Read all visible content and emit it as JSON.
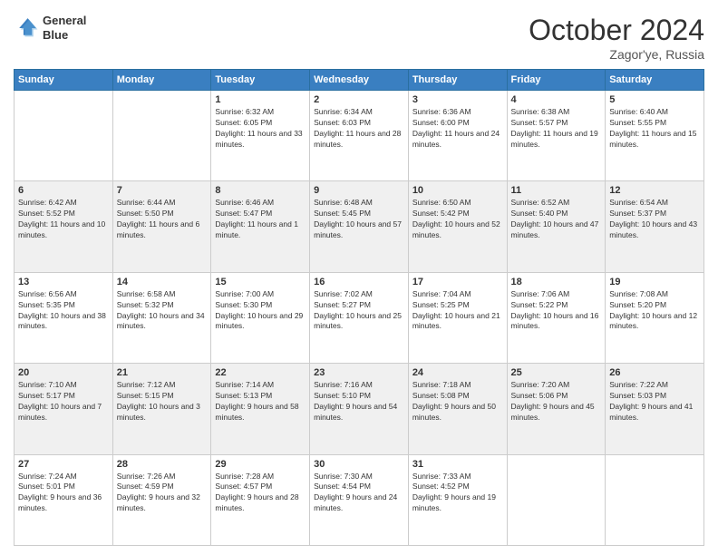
{
  "header": {
    "logo_line1": "General",
    "logo_line2": "Blue",
    "month": "October 2024",
    "location": "Zagor'ye, Russia"
  },
  "days_of_week": [
    "Sunday",
    "Monday",
    "Tuesday",
    "Wednesday",
    "Thursday",
    "Friday",
    "Saturday"
  ],
  "weeks": [
    [
      {
        "day": "",
        "sunrise": "",
        "sunset": "",
        "daylight": ""
      },
      {
        "day": "",
        "sunrise": "",
        "sunset": "",
        "daylight": ""
      },
      {
        "day": "1",
        "sunrise": "Sunrise: 6:32 AM",
        "sunset": "Sunset: 6:05 PM",
        "daylight": "Daylight: 11 hours and 33 minutes."
      },
      {
        "day": "2",
        "sunrise": "Sunrise: 6:34 AM",
        "sunset": "Sunset: 6:03 PM",
        "daylight": "Daylight: 11 hours and 28 minutes."
      },
      {
        "day": "3",
        "sunrise": "Sunrise: 6:36 AM",
        "sunset": "Sunset: 6:00 PM",
        "daylight": "Daylight: 11 hours and 24 minutes."
      },
      {
        "day": "4",
        "sunrise": "Sunrise: 6:38 AM",
        "sunset": "Sunset: 5:57 PM",
        "daylight": "Daylight: 11 hours and 19 minutes."
      },
      {
        "day": "5",
        "sunrise": "Sunrise: 6:40 AM",
        "sunset": "Sunset: 5:55 PM",
        "daylight": "Daylight: 11 hours and 15 minutes."
      }
    ],
    [
      {
        "day": "6",
        "sunrise": "Sunrise: 6:42 AM",
        "sunset": "Sunset: 5:52 PM",
        "daylight": "Daylight: 11 hours and 10 minutes."
      },
      {
        "day": "7",
        "sunrise": "Sunrise: 6:44 AM",
        "sunset": "Sunset: 5:50 PM",
        "daylight": "Daylight: 11 hours and 6 minutes."
      },
      {
        "day": "8",
        "sunrise": "Sunrise: 6:46 AM",
        "sunset": "Sunset: 5:47 PM",
        "daylight": "Daylight: 11 hours and 1 minute."
      },
      {
        "day": "9",
        "sunrise": "Sunrise: 6:48 AM",
        "sunset": "Sunset: 5:45 PM",
        "daylight": "Daylight: 10 hours and 57 minutes."
      },
      {
        "day": "10",
        "sunrise": "Sunrise: 6:50 AM",
        "sunset": "Sunset: 5:42 PM",
        "daylight": "Daylight: 10 hours and 52 minutes."
      },
      {
        "day": "11",
        "sunrise": "Sunrise: 6:52 AM",
        "sunset": "Sunset: 5:40 PM",
        "daylight": "Daylight: 10 hours and 47 minutes."
      },
      {
        "day": "12",
        "sunrise": "Sunrise: 6:54 AM",
        "sunset": "Sunset: 5:37 PM",
        "daylight": "Daylight: 10 hours and 43 minutes."
      }
    ],
    [
      {
        "day": "13",
        "sunrise": "Sunrise: 6:56 AM",
        "sunset": "Sunset: 5:35 PM",
        "daylight": "Daylight: 10 hours and 38 minutes."
      },
      {
        "day": "14",
        "sunrise": "Sunrise: 6:58 AM",
        "sunset": "Sunset: 5:32 PM",
        "daylight": "Daylight: 10 hours and 34 minutes."
      },
      {
        "day": "15",
        "sunrise": "Sunrise: 7:00 AM",
        "sunset": "Sunset: 5:30 PM",
        "daylight": "Daylight: 10 hours and 29 minutes."
      },
      {
        "day": "16",
        "sunrise": "Sunrise: 7:02 AM",
        "sunset": "Sunset: 5:27 PM",
        "daylight": "Daylight: 10 hours and 25 minutes."
      },
      {
        "day": "17",
        "sunrise": "Sunrise: 7:04 AM",
        "sunset": "Sunset: 5:25 PM",
        "daylight": "Daylight: 10 hours and 21 minutes."
      },
      {
        "day": "18",
        "sunrise": "Sunrise: 7:06 AM",
        "sunset": "Sunset: 5:22 PM",
        "daylight": "Daylight: 10 hours and 16 minutes."
      },
      {
        "day": "19",
        "sunrise": "Sunrise: 7:08 AM",
        "sunset": "Sunset: 5:20 PM",
        "daylight": "Daylight: 10 hours and 12 minutes."
      }
    ],
    [
      {
        "day": "20",
        "sunrise": "Sunrise: 7:10 AM",
        "sunset": "Sunset: 5:17 PM",
        "daylight": "Daylight: 10 hours and 7 minutes."
      },
      {
        "day": "21",
        "sunrise": "Sunrise: 7:12 AM",
        "sunset": "Sunset: 5:15 PM",
        "daylight": "Daylight: 10 hours and 3 minutes."
      },
      {
        "day": "22",
        "sunrise": "Sunrise: 7:14 AM",
        "sunset": "Sunset: 5:13 PM",
        "daylight": "Daylight: 9 hours and 58 minutes."
      },
      {
        "day": "23",
        "sunrise": "Sunrise: 7:16 AM",
        "sunset": "Sunset: 5:10 PM",
        "daylight": "Daylight: 9 hours and 54 minutes."
      },
      {
        "day": "24",
        "sunrise": "Sunrise: 7:18 AM",
        "sunset": "Sunset: 5:08 PM",
        "daylight": "Daylight: 9 hours and 50 minutes."
      },
      {
        "day": "25",
        "sunrise": "Sunrise: 7:20 AM",
        "sunset": "Sunset: 5:06 PM",
        "daylight": "Daylight: 9 hours and 45 minutes."
      },
      {
        "day": "26",
        "sunrise": "Sunrise: 7:22 AM",
        "sunset": "Sunset: 5:03 PM",
        "daylight": "Daylight: 9 hours and 41 minutes."
      }
    ],
    [
      {
        "day": "27",
        "sunrise": "Sunrise: 7:24 AM",
        "sunset": "Sunset: 5:01 PM",
        "daylight": "Daylight: 9 hours and 36 minutes."
      },
      {
        "day": "28",
        "sunrise": "Sunrise: 7:26 AM",
        "sunset": "Sunset: 4:59 PM",
        "daylight": "Daylight: 9 hours and 32 minutes."
      },
      {
        "day": "29",
        "sunrise": "Sunrise: 7:28 AM",
        "sunset": "Sunset: 4:57 PM",
        "daylight": "Daylight: 9 hours and 28 minutes."
      },
      {
        "day": "30",
        "sunrise": "Sunrise: 7:30 AM",
        "sunset": "Sunset: 4:54 PM",
        "daylight": "Daylight: 9 hours and 24 minutes."
      },
      {
        "day": "31",
        "sunrise": "Sunrise: 7:33 AM",
        "sunset": "Sunset: 4:52 PM",
        "daylight": "Daylight: 9 hours and 19 minutes."
      },
      {
        "day": "",
        "sunrise": "",
        "sunset": "",
        "daylight": ""
      },
      {
        "day": "",
        "sunrise": "",
        "sunset": "",
        "daylight": ""
      }
    ]
  ]
}
